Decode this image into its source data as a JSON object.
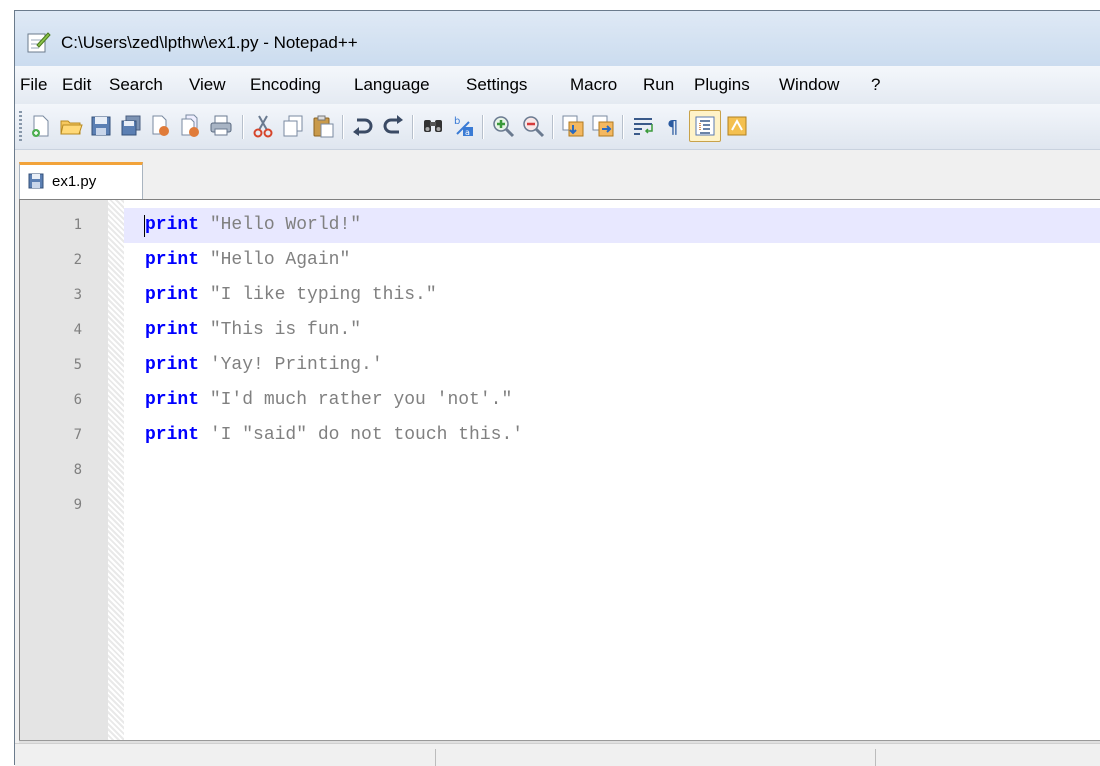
{
  "window": {
    "title": "C:\\Users\\zed\\lpthw\\ex1.py - Notepad++"
  },
  "menu": [
    "File",
    "Edit",
    "Search",
    "View",
    "Encoding",
    "Language",
    "Settings",
    "Macro",
    "Run",
    "Plugins",
    "Window",
    "?"
  ],
  "toolbar": {
    "buttons": [
      "new-file-icon",
      "open-file-icon",
      "save-icon",
      "save-all-icon",
      "close-icon",
      "close-all-icon",
      "print-icon",
      "cut-icon",
      "copy-icon",
      "paste-icon",
      "undo-icon",
      "redo-icon",
      "find-icon",
      "replace-icon",
      "zoom-in-icon",
      "zoom-out-icon",
      "sync-vertical-icon",
      "sync-horizontal-icon",
      "word-wrap-icon",
      "show-all-chars-icon",
      "indent-guide-icon",
      "user-language-icon"
    ]
  },
  "tabs": [
    {
      "label": "ex1.py"
    }
  ],
  "editor": {
    "lines": [
      {
        "num": "1",
        "kw": "print",
        "rest": " \"Hello World!\""
      },
      {
        "num": "2",
        "kw": "print",
        "rest": " \"Hello Again\""
      },
      {
        "num": "3",
        "kw": "print",
        "rest": " \"I like typing this.\""
      },
      {
        "num": "4",
        "kw": "print",
        "rest": " \"This is fun.\""
      },
      {
        "num": "5",
        "kw": "print",
        "rest": " 'Yay! Printing.'"
      },
      {
        "num": "6",
        "kw": "print",
        "rest": " \"I'd much rather you 'not'.\""
      },
      {
        "num": "7",
        "kw": "print",
        "rest": " 'I \"said\" do not touch this.'"
      },
      {
        "num": "8",
        "kw": "",
        "rest": ""
      },
      {
        "num": "9",
        "kw": "",
        "rest": ""
      }
    ],
    "current_line": "1"
  },
  "colors": {
    "keyword": "#0000ff",
    "string": "#808080",
    "current_line": "#e8e8ff",
    "tab_accent": "#f2a33a"
  }
}
